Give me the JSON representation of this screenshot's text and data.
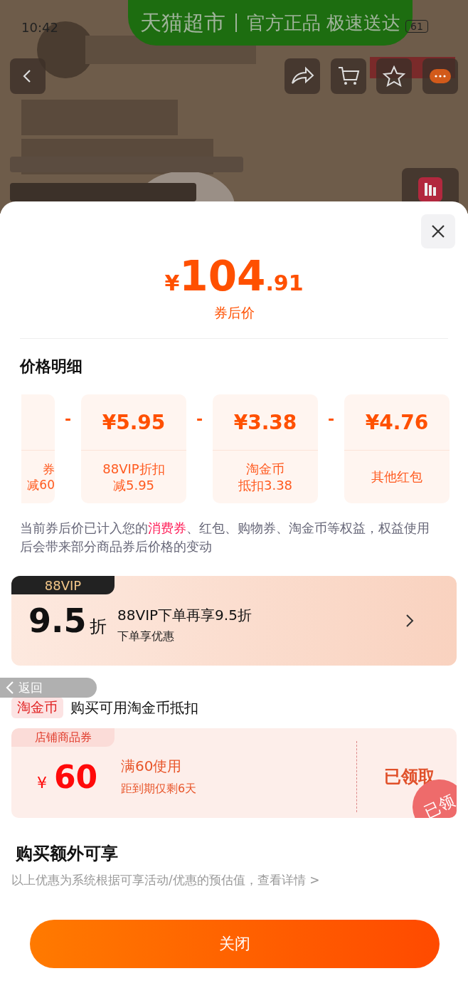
{
  "status_bar": {
    "time": "10:42",
    "battery": "61"
  },
  "banner": {
    "title": "天猫超市",
    "slogan": "官方正品 极速送达"
  },
  "sheet": {
    "price": {
      "currency": "¥",
      "integer": "104",
      "decimal": ".91",
      "caption": "券后价"
    },
    "breakdown_title": "价格明细",
    "breakdown": [
      {
        "line1": "券",
        "line2": "减60"
      },
      {
        "price": "¥5.95",
        "line1": "88VIP折扣",
        "line2": "减5.95"
      },
      {
        "price": "¥3.38",
        "line1": "淘金币",
        "line2": "抵扣3.38"
      },
      {
        "price": "¥4.76",
        "line1": "其他红包"
      }
    ],
    "separator": "-",
    "note": "当前券后价已计入您的**消费券**、红包、购物券、淘金币等权益，权益使用后会带来部分商品券后价格的变动",
    "vip": {
      "tag": "88VIP",
      "discount": "9.5",
      "unit": "折",
      "title": "88VIP下单再享9.5折",
      "subtitle": "下单享优惠"
    },
    "coin": {
      "tag": "淘金币",
      "text": "购买可用淘金币抵扣"
    },
    "coupon": {
      "tag": "店铺商品券",
      "currency": "¥",
      "amount": "60",
      "condition": "满60使用",
      "expiry": "距到期仅剩6天",
      "action": "已领取",
      "stamp": "已领"
    },
    "extra_title": "购买额外可享",
    "extra_note": "以上优惠为系统根据可享活动/优惠的预估值，查看详情 >",
    "close_button": "关闭"
  },
  "back_gesture": "返回"
}
